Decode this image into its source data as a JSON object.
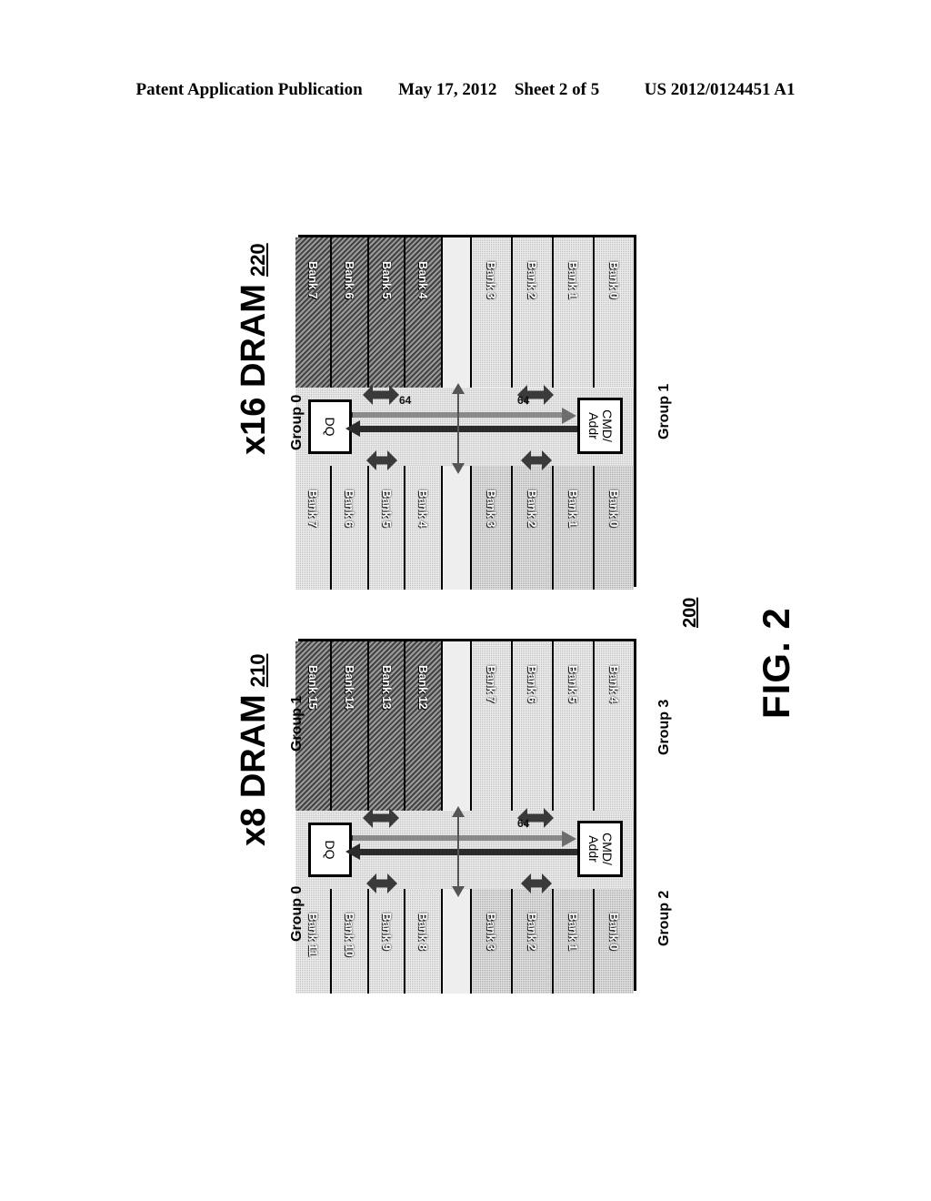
{
  "header": {
    "publication": "Patent Application Publication",
    "date": "May 17, 2012",
    "sheet": "Sheet 2 of 5",
    "number": "US 2012/0124451 A1"
  },
  "figure": {
    "label": "FIG. 2",
    "reference": "200"
  },
  "diagrams": [
    {
      "id": "x16",
      "title": "x16 DRAM",
      "reference": "220",
      "cmd_addr_label": "CMD/\nAddr",
      "dq_label": "DQ",
      "bus_width_label": "64",
      "groups": [
        {
          "name": "Group 0",
          "shade": "light",
          "banks": [
            "Bank 0",
            "Bank 1",
            "Bank 2",
            "Bank 3"
          ]
        },
        {
          "name": "Group 1",
          "shade": "dark",
          "banks": [
            "Bank 4",
            "Bank 5",
            "Bank 6",
            "Bank 7"
          ]
        },
        {
          "name": "Group 0",
          "shade": "mid",
          "banks": [
            "Bank 0",
            "Bank 1",
            "Bank 2",
            "Bank 3"
          ]
        },
        {
          "name": "Group 1",
          "shade": "light",
          "banks": [
            "Bank 4",
            "Bank 5",
            "Bank 6",
            "Bank 7"
          ]
        }
      ]
    },
    {
      "id": "x8",
      "title": "x8 DRAM",
      "reference": "210",
      "cmd_addr_label": "CMD/\nAddr",
      "dq_label": "DQ",
      "bus_width_label": "64",
      "groups": [
        {
          "name": "Group 1",
          "shade": "light",
          "banks": [
            "Bank 4",
            "Bank 5",
            "Bank 6",
            "Bank 7"
          ]
        },
        {
          "name": "Group 3",
          "shade": "dark",
          "banks": [
            "Bank 12",
            "Bank 13",
            "Bank 14",
            "Bank 15"
          ]
        },
        {
          "name": "Group 0",
          "shade": "mid",
          "banks": [
            "Bank 0",
            "Bank 1",
            "Bank 2",
            "Bank 3"
          ]
        },
        {
          "name": "Group 2",
          "shade": "light",
          "banks": [
            "Bank 8",
            "Bank 9",
            "Bank 10",
            "Bank 11"
          ]
        }
      ]
    }
  ]
}
